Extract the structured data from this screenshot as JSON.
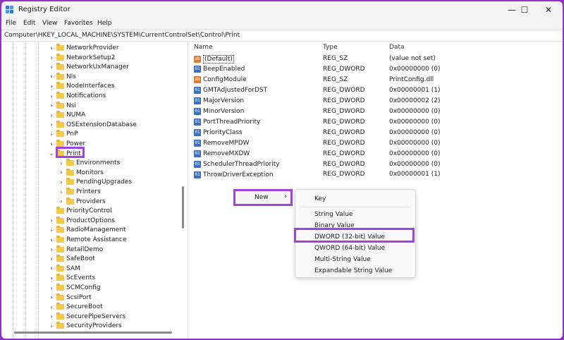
{
  "window": {
    "title": "Registry Editor",
    "controls": {
      "minimize": "—",
      "maximize": "☐",
      "close": "✕"
    }
  },
  "menubar": [
    "File",
    "Edit",
    "View",
    "Favorites",
    "Help"
  ],
  "address": "Computer\\HKEY_LOCAL_MACHINE\\SYSTEM\\CurrentControlSet\\Control\\Print",
  "tree": [
    {
      "label": "NetworkProvider",
      "level": 0,
      "expandable": true
    },
    {
      "label": "NetworkSetup2",
      "level": 0,
      "expandable": true
    },
    {
      "label": "NetworkUxManager",
      "level": 0,
      "expandable": true
    },
    {
      "label": "Nls",
      "level": 0,
      "expandable": true
    },
    {
      "label": "NodeInterfaces",
      "level": 0,
      "expandable": true
    },
    {
      "label": "Notifications",
      "level": 0,
      "expandable": true
    },
    {
      "label": "Nsi",
      "level": 0,
      "expandable": true
    },
    {
      "label": "NUMA",
      "level": 0,
      "expandable": true
    },
    {
      "label": "OSExtensionDatabase",
      "level": 0,
      "expandable": true
    },
    {
      "label": "PnP",
      "level": 0,
      "expandable": true
    },
    {
      "label": "Power",
      "level": 0,
      "expandable": true
    },
    {
      "label": "Print",
      "level": 0,
      "expandable": true,
      "expanded": true,
      "selected": true
    },
    {
      "label": "Environments",
      "level": 1,
      "expandable": true
    },
    {
      "label": "Monitors",
      "level": 1,
      "expandable": true
    },
    {
      "label": "PendingUpgrades",
      "level": 1,
      "expandable": true
    },
    {
      "label": "Printers",
      "level": 1,
      "expandable": true
    },
    {
      "label": "Providers",
      "level": 1,
      "expandable": true
    },
    {
      "label": "PriorityControl",
      "level": 0,
      "expandable": false
    },
    {
      "label": "ProductOptions",
      "level": 0,
      "expandable": true
    },
    {
      "label": "RadioManagement",
      "level": 0,
      "expandable": true
    },
    {
      "label": "Remote Assistance",
      "level": 0,
      "expandable": true
    },
    {
      "label": "RetailDemo",
      "level": 0,
      "expandable": true
    },
    {
      "label": "SafeBoot",
      "level": 0,
      "expandable": true
    },
    {
      "label": "SAM",
      "level": 0,
      "expandable": true
    },
    {
      "label": "ScEvents",
      "level": 0,
      "expandable": true
    },
    {
      "label": "SCMConfig",
      "level": 0,
      "expandable": true
    },
    {
      "label": "ScsiPort",
      "level": 0,
      "expandable": true
    },
    {
      "label": "SecureBoot",
      "level": 0,
      "expandable": true
    },
    {
      "label": "SecurePipeServers",
      "level": 0,
      "expandable": true
    },
    {
      "label": "SecurityProviders",
      "level": 0,
      "expandable": true
    }
  ],
  "columns": {
    "name": "Name",
    "type": "Type",
    "data": "Data"
  },
  "values": [
    {
      "name": "(Default)",
      "type": "REG_SZ",
      "data": "(value not set)",
      "icon": "string-value-icon",
      "kind": "sz"
    },
    {
      "name": "BeepEnabled",
      "type": "REG_DWORD",
      "data": "0x00000000 (0)",
      "icon": "binary-value-icon",
      "kind": "dw"
    },
    {
      "name": "ConfigModule",
      "type": "REG_SZ",
      "data": "PrintConfig.dll",
      "icon": "string-value-icon",
      "kind": "sz"
    },
    {
      "name": "GMTAdjustedForDST",
      "type": "REG_DWORD",
      "data": "0x00000001 (1)",
      "icon": "binary-value-icon",
      "kind": "dw"
    },
    {
      "name": "MajorVersion",
      "type": "REG_DWORD",
      "data": "0x00000002 (2)",
      "icon": "binary-value-icon",
      "kind": "dw"
    },
    {
      "name": "MinorVersion",
      "type": "REG_DWORD",
      "data": "0x00000000 (0)",
      "icon": "binary-value-icon",
      "kind": "dw"
    },
    {
      "name": "PortThreadPriority",
      "type": "REG_DWORD",
      "data": "0x00000000 (0)",
      "icon": "binary-value-icon",
      "kind": "dw"
    },
    {
      "name": "PriorityClass",
      "type": "REG_DWORD",
      "data": "0x00000000 (0)",
      "icon": "binary-value-icon",
      "kind": "dw"
    },
    {
      "name": "RemoveMPDW",
      "type": "REG_DWORD",
      "data": "0x00000000 (0)",
      "icon": "binary-value-icon",
      "kind": "dw"
    },
    {
      "name": "RemoveMXDW",
      "type": "REG_DWORD",
      "data": "0x00000000 (0)",
      "icon": "binary-value-icon",
      "kind": "dw"
    },
    {
      "name": "SchedulerThreadPriority",
      "type": "REG_DWORD",
      "data": "0x00000000 (0)",
      "icon": "binary-value-icon",
      "kind": "dw"
    },
    {
      "name": "ThrowDriverException",
      "type": "REG_DWORD",
      "data": "0x00000001 (1)",
      "icon": "binary-value-icon",
      "kind": "dw"
    }
  ],
  "context_menu": {
    "new_label": "New",
    "new_arrow": "›",
    "submenu": {
      "key": "Key",
      "string_value": "String Value",
      "binary_value": "Binary Value",
      "dword_value": "DWORD (32-bit) Value",
      "qword_value": "QWORD (64-bit) Value",
      "multi_string_value": "Multi-String Value",
      "expandable_string_value": "Expandable String Value"
    }
  },
  "colors": {
    "highlight": "#a044e0",
    "folder": "#f2c94c",
    "background": "#8e33c8"
  }
}
